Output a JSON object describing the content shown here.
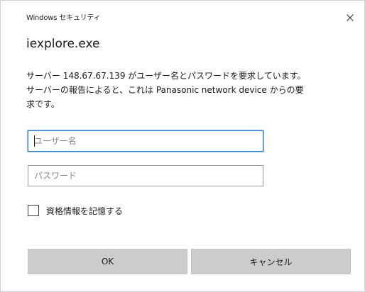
{
  "window": {
    "title": "Windows セキュリティ",
    "close_glyph": "close-icon"
  },
  "dialog": {
    "app_name": "iexplore.exe",
    "message_lines": [
      "サーバー 148.67.67.139 がユーザー名とパスワードを要求しています。",
      "サーバーの報告によると、これは Panasonic network device からの要",
      "求です。"
    ],
    "username": {
      "placeholder": "ユーザー名",
      "value": ""
    },
    "password": {
      "placeholder": "パスワード",
      "value": ""
    },
    "remember": {
      "label": "資格情報を記憶する",
      "checked": false
    },
    "ok_label": "OK",
    "cancel_label": "キャンセル"
  },
  "colors": {
    "focus_border": "#2f7bd6",
    "button_bg": "#cccccc",
    "window_border": "#c8d3dd"
  }
}
